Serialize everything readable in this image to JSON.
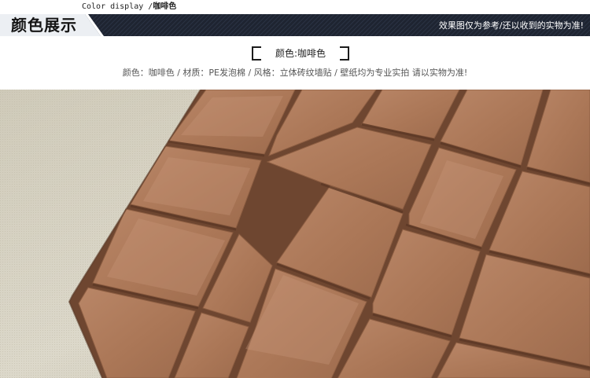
{
  "header": {
    "caption_en": "Color display /",
    "caption_cn": "咖啡色",
    "title": "颜色展示",
    "note": "效果图仅为参考/还以收到的实物为准!"
  },
  "color_label": "颜色:咖啡色",
  "spec_line": "颜色：咖啡色 / 材质：PE发泡棉 / 风格：立体砖纹墙贴 / 壁纸均为专业实拍 请以实物为准!",
  "photo": {
    "subject": "3D brick wall sticker in coffee color on fabric background",
    "brick_color": "#ae7a5a",
    "mortar_color": "#6e4630",
    "background_color": "#d8d3c4"
  },
  "colors": {
    "banner_dark": "#1e2431",
    "banner_light": "#eceff3"
  }
}
